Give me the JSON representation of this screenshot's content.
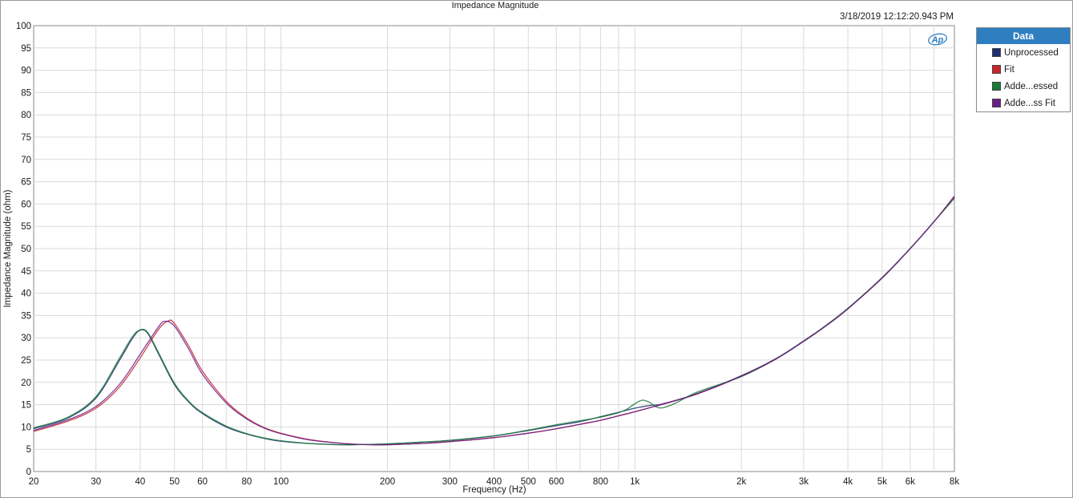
{
  "timestamp": "3/18/2019 12:12:20.943 PM",
  "legend": {
    "header": "Data",
    "items": [
      {
        "label": "Unprocessed",
        "color": "#1f2e6e"
      },
      {
        "label": "Fit",
        "color": "#c8252b"
      },
      {
        "label": "Adde...essed",
        "color": "#1a7a3a"
      },
      {
        "label": "Adde...ss Fit",
        "color": "#6a1f8a"
      }
    ]
  },
  "chart_data": {
    "type": "line",
    "title": "Impedance Magnitude",
    "xlabel": "Frequency (Hz)",
    "ylabel": "Impedance Magnitude (ohm)",
    "xscale": "log",
    "xlim": [
      20,
      8000
    ],
    "ylim": [
      0,
      100
    ],
    "grid": true,
    "legend_position": "right",
    "x_ticks": [
      {
        "value": 20,
        "label": "20"
      },
      {
        "value": 30,
        "label": "30"
      },
      {
        "value": 40,
        "label": "40"
      },
      {
        "value": 50,
        "label": "50"
      },
      {
        "value": 60,
        "label": "60"
      },
      {
        "value": 80,
        "label": "80"
      },
      {
        "value": 100,
        "label": "100"
      },
      {
        "value": 200,
        "label": "200"
      },
      {
        "value": 300,
        "label": "300"
      },
      {
        "value": 400,
        "label": "400"
      },
      {
        "value": 500,
        "label": "500"
      },
      {
        "value": 600,
        "label": "600"
      },
      {
        "value": 800,
        "label": "800"
      },
      {
        "value": 1000,
        "label": "1k"
      },
      {
        "value": 2000,
        "label": "2k"
      },
      {
        "value": 3000,
        "label": "3k"
      },
      {
        "value": 4000,
        "label": "4k"
      },
      {
        "value": 5000,
        "label": "5k"
      },
      {
        "value": 6000,
        "label": "6k"
      },
      {
        "value": 8000,
        "label": "8k"
      }
    ],
    "y_ticks": [
      0,
      5,
      10,
      15,
      20,
      25,
      30,
      35,
      40,
      45,
      50,
      55,
      60,
      65,
      70,
      75,
      80,
      85,
      90,
      95,
      100
    ],
    "series": [
      {
        "name": "Unprocessed",
        "color": "#1f2e6e",
        "x": [
          20,
          25,
          30,
          35,
          38,
          40,
          42,
          45,
          50,
          55,
          60,
          70,
          80,
          90,
          100,
          120,
          150,
          180,
          200,
          250,
          300,
          400,
          500,
          600,
          700,
          800,
          900,
          1000,
          1100,
          1200,
          1500,
          2000,
          2500,
          3000,
          3500,
          4000,
          5000,
          6000,
          7000,
          8000
        ],
        "y": [
          9.6,
          12.0,
          16.5,
          25.0,
          29.8,
          31.7,
          31.0,
          26.5,
          19.5,
          15.5,
          13.0,
          10.0,
          8.4,
          7.4,
          6.8,
          6.3,
          6.0,
          6.1,
          6.2,
          6.6,
          7.0,
          8.0,
          9.2,
          10.3,
          11.2,
          12.3,
          13.3,
          14.2,
          14.8,
          15.2,
          17.5,
          21.5,
          25.3,
          29.3,
          33.0,
          36.6,
          43.5,
          50.0,
          56.0,
          61.5
        ]
      },
      {
        "name": "Fit",
        "color": "#c8252b",
        "x": [
          20,
          25,
          30,
          35,
          40,
          45,
          48,
          50,
          55,
          60,
          70,
          80,
          90,
          100,
          120,
          150,
          180,
          200,
          250,
          300,
          400,
          500,
          600,
          700,
          800,
          900,
          1000,
          1100,
          1200,
          1500,
          2000,
          2500,
          3000,
          3500,
          4000,
          5000,
          6000,
          7000,
          8000
        ],
        "y": [
          9.0,
          11.3,
          14.2,
          19.0,
          25.5,
          31.8,
          33.8,
          33.2,
          28.0,
          22.5,
          15.8,
          12.0,
          9.8,
          8.6,
          7.2,
          6.3,
          6.0,
          6.0,
          6.3,
          6.7,
          7.6,
          8.6,
          9.6,
          10.6,
          11.5,
          12.5,
          13.4,
          14.3,
          15.1,
          17.4,
          21.4,
          25.2,
          29.2,
          32.9,
          36.5,
          43.4,
          50.0,
          56.0,
          61.5
        ]
      },
      {
        "name": "Adde...essed",
        "color": "#1a7a3a",
        "x": [
          20,
          25,
          30,
          35,
          38,
          40,
          42,
          45,
          50,
          55,
          60,
          70,
          80,
          90,
          100,
          120,
          150,
          180,
          200,
          250,
          300,
          400,
          500,
          600,
          700,
          800,
          900,
          950,
          1000,
          1050,
          1100,
          1150,
          1200,
          1300,
          1500,
          2000,
          2500,
          3000,
          3500,
          4000,
          5000,
          6000,
          7000,
          8000
        ],
        "y": [
          9.8,
          12.2,
          16.8,
          25.5,
          30.2,
          31.8,
          31.2,
          26.8,
          19.8,
          15.7,
          13.2,
          10.2,
          8.5,
          7.5,
          6.9,
          6.3,
          6.0,
          6.1,
          6.2,
          6.6,
          7.0,
          8.0,
          9.3,
          10.5,
          11.4,
          12.2,
          13.2,
          14.0,
          15.2,
          16.0,
          15.5,
          14.5,
          14.3,
          15.3,
          17.8,
          21.3,
          25.2,
          29.2,
          33.0,
          36.6,
          43.5,
          50.0,
          56.0,
          61.3
        ]
      },
      {
        "name": "Adde...ss Fit",
        "color": "#6a1f8a",
        "x": [
          20,
          25,
          30,
          35,
          40,
          45,
          47,
          50,
          55,
          60,
          70,
          80,
          90,
          100,
          120,
          150,
          180,
          200,
          250,
          300,
          400,
          500,
          600,
          700,
          800,
          900,
          1000,
          1100,
          1200,
          1500,
          2000,
          2500,
          3000,
          3500,
          4000,
          5000,
          6000,
          7000,
          8000
        ],
        "y": [
          9.2,
          11.6,
          14.6,
          19.6,
          26.3,
          32.4,
          33.7,
          32.6,
          27.3,
          21.8,
          15.4,
          11.8,
          9.7,
          8.5,
          7.1,
          6.3,
          6.0,
          6.0,
          6.3,
          6.7,
          7.6,
          8.6,
          9.6,
          10.6,
          11.5,
          12.5,
          13.4,
          14.3,
          15.1,
          17.4,
          21.4,
          25.2,
          29.2,
          32.9,
          36.5,
          43.4,
          50.0,
          56.0,
          61.8
        ]
      }
    ]
  }
}
